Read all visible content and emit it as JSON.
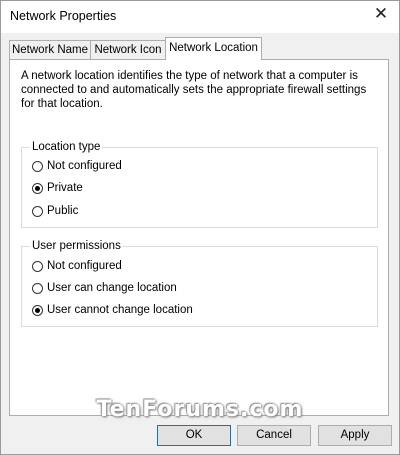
{
  "window": {
    "title": "Network Properties",
    "close_glyph": "✕"
  },
  "tabs": [
    {
      "label": "Network Name",
      "active": false
    },
    {
      "label": "Network Icon",
      "active": false
    },
    {
      "label": "Network Location",
      "active": true
    }
  ],
  "description": "A network location identifies the type of network that a computer is connected to and automatically sets the appropriate firewall settings for that location.",
  "location_type": {
    "legend": "Location type",
    "options": [
      {
        "label": "Not configured",
        "checked": false
      },
      {
        "label": "Private",
        "checked": true
      },
      {
        "label": "Public",
        "checked": false
      }
    ]
  },
  "user_permissions": {
    "legend": "User permissions",
    "options": [
      {
        "label": "Not configured",
        "checked": false
      },
      {
        "label": "User can change location",
        "checked": false
      },
      {
        "label": "User cannot change location",
        "checked": true
      }
    ]
  },
  "watermark": "TenForums.com",
  "buttons": {
    "ok": "OK",
    "cancel": "Cancel",
    "apply": "Apply"
  },
  "icons": {
    "close": "close-icon",
    "radio": "radio-button"
  }
}
